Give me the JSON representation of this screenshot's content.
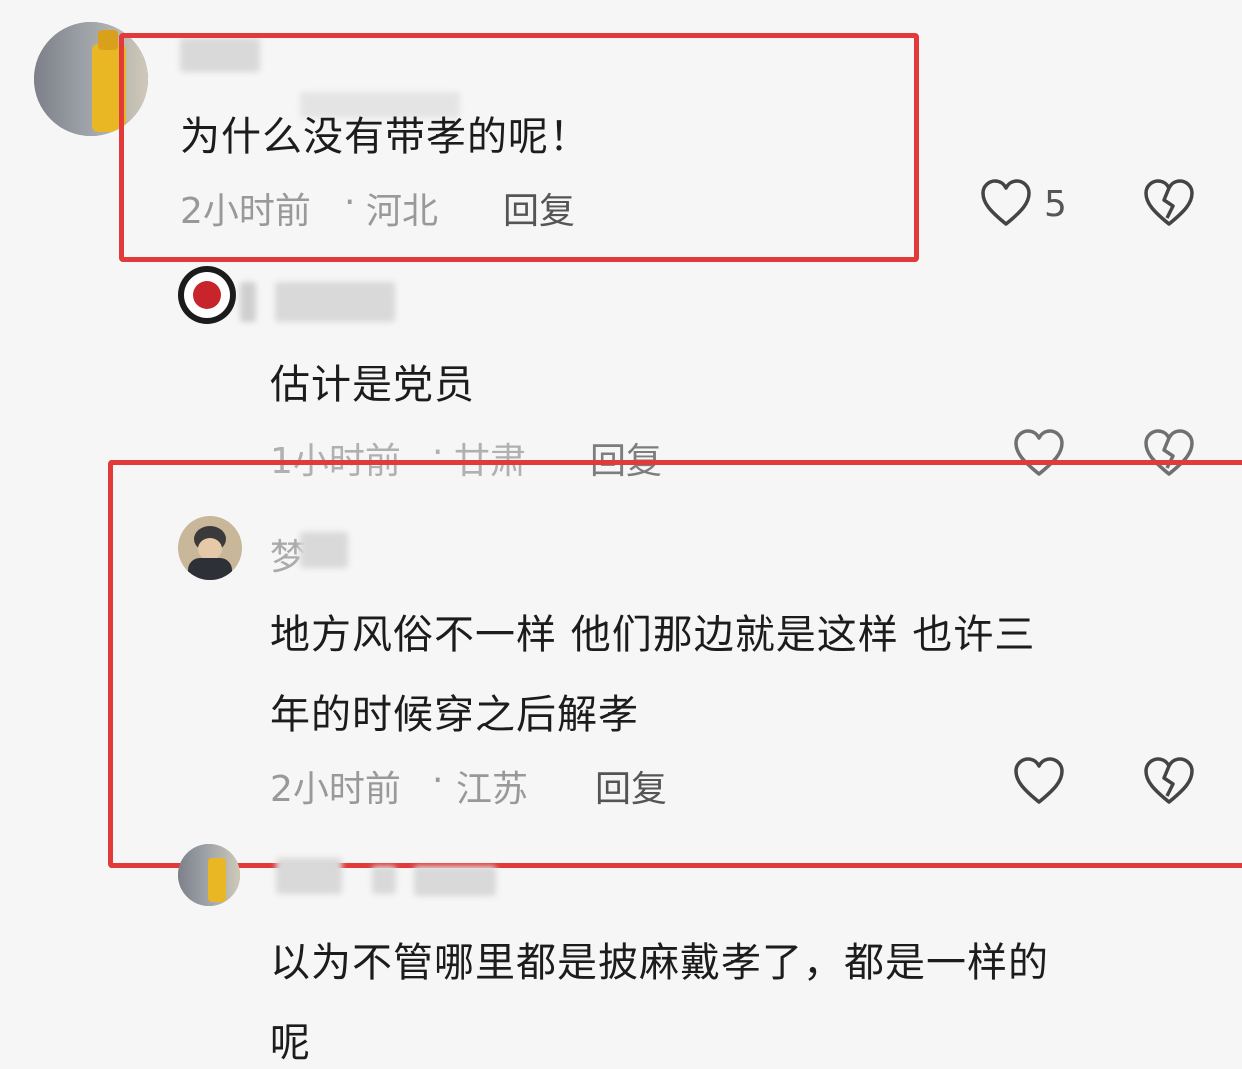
{
  "comments": [
    {
      "text": "为什么没有带孝的呢！",
      "time": "2小时前",
      "sep": "·",
      "location": "河北",
      "reply": "回复",
      "likes": "5"
    },
    {
      "text": "估计是党员",
      "time": "1小时前",
      "sep": "·",
      "location": "甘肃",
      "reply": "回复"
    },
    {
      "name_partial": "梦",
      "text_line1": "地方风俗不一样  他们那边就是这样  也许三",
      "text_line2": "年的时候穿之后解孝",
      "time": "2小时前",
      "sep": "·",
      "location": "江苏",
      "reply": "回复"
    },
    {
      "text_line1": "以为不管哪里都是披麻戴孝了，都是一样的",
      "text_line2": "呢"
    }
  ],
  "colors": {
    "highlight": "#e23a3a",
    "meta": "#999999"
  },
  "icons": {
    "like": "heart-outline-icon",
    "dislike": "broken-heart-icon"
  }
}
